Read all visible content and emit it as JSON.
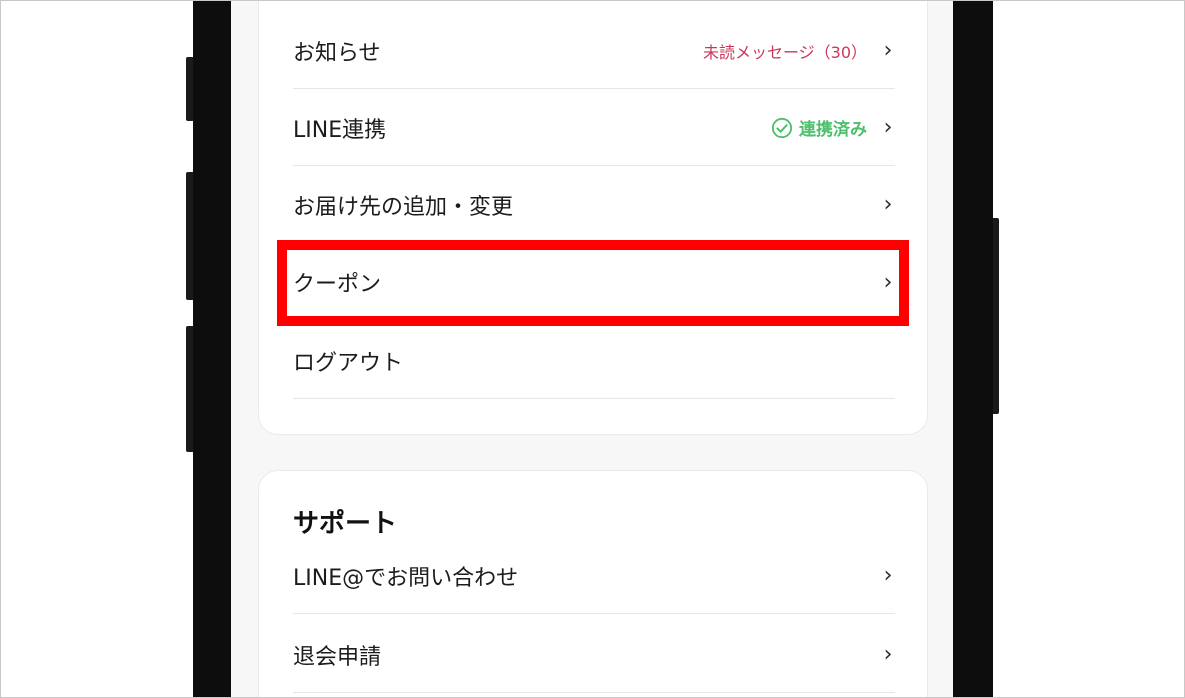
{
  "account_menu": {
    "items": [
      {
        "label": "お知らせ",
        "badge": "未読メッセージ（30）",
        "chevron": "›"
      },
      {
        "label": "LINE連携",
        "status": "連携済み",
        "status_icon": "check-circle-icon",
        "chevron": "›"
      },
      {
        "label": "お届け先の追加・変更",
        "chevron": "›"
      },
      {
        "label": "クーポン",
        "chevron": "›"
      },
      {
        "label": "ログアウト"
      }
    ]
  },
  "support": {
    "title": "サポート",
    "items": [
      {
        "label": "LINE@でお問い合わせ",
        "chevron": "›"
      },
      {
        "label": "退会申請",
        "chevron": "›"
      }
    ]
  },
  "colors": {
    "unread_text": "#c9385a",
    "linked_text": "#4bbf6b",
    "highlight_border": "#ff0000"
  }
}
